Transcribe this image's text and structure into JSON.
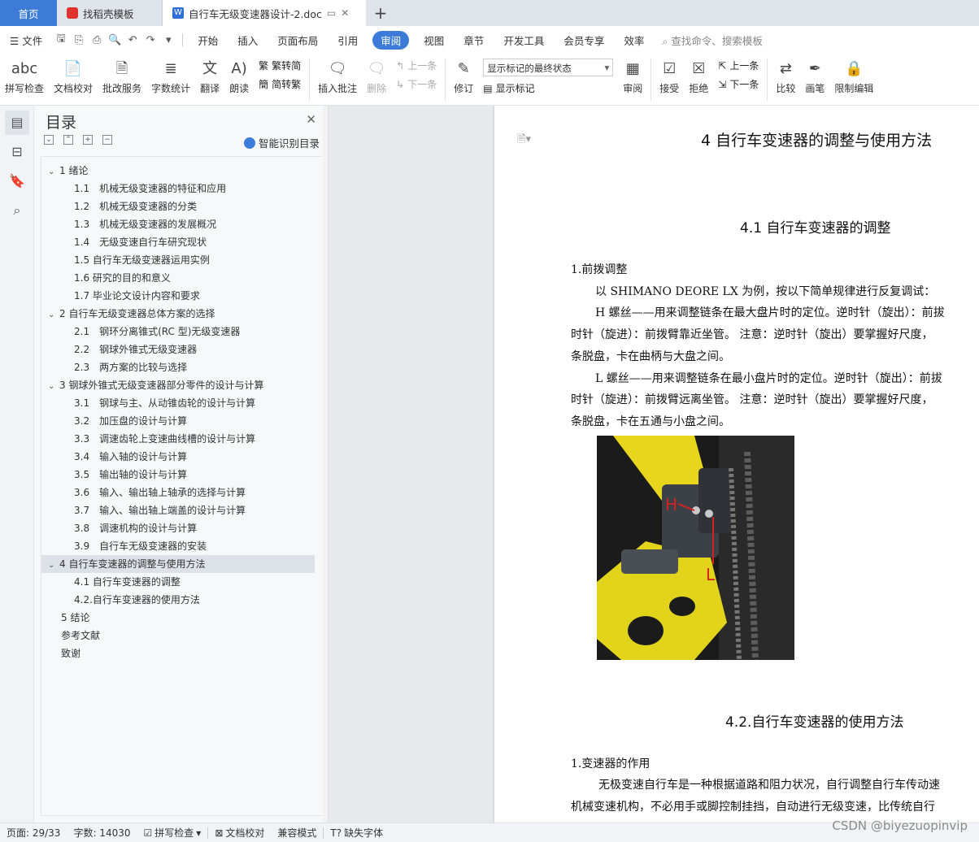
{
  "tabs": {
    "home": "首页",
    "template": "找稻壳模板",
    "document": "自行车无级变速器设计-2.doc"
  },
  "menu": {
    "file": "文件",
    "items": [
      "开始",
      "插入",
      "页面布局",
      "引用",
      "审阅",
      "视图",
      "章节",
      "开发工具",
      "会员专享",
      "效率"
    ],
    "active": "审阅",
    "search": "查找命令、搜索模板"
  },
  "ribbon": {
    "spellcheck": "拼写检查",
    "doccheck": "文档校对",
    "batch": "批改服务",
    "wordcount": "字数统计",
    "translate": "翻译",
    "read": "朗读",
    "to_trad": "繁转简",
    "to_simp": "简转繁",
    "insert_comment": "插入批注",
    "delete": "删除",
    "prev": "上一条",
    "next": "下一条",
    "revise": "修订",
    "markup_state": "显示标记的最终状态",
    "show_markup": "显示标记",
    "review": "审阅",
    "accept": "接受",
    "reject": "拒绝",
    "prev2": "上一条",
    "next2": "下一条",
    "compare": "比较",
    "pen": "画笔",
    "restrict": "限制编辑"
  },
  "toc": {
    "title": "目录",
    "smart": "智能识别目录",
    "items": [
      {
        "level": 1,
        "text": "1 绪论",
        "caret": true
      },
      {
        "level": 2,
        "text": "1.1　机械无级变速器的特征和应用"
      },
      {
        "level": 2,
        "text": "1.2　机械无级变速器的分类"
      },
      {
        "level": 2,
        "text": "1.3　机械无级变速器的发展概况"
      },
      {
        "level": 2,
        "text": "1.4　无级变速自行车研究现状"
      },
      {
        "level": 2,
        "text": "1.5 自行车无级变速器运用实例"
      },
      {
        "level": 2,
        "text": "1.6 研究的目的和意义"
      },
      {
        "level": 2,
        "text": "1.7 毕业论文设计内容和要求"
      },
      {
        "level": 1,
        "text": "2 自行车无级变速器总体方案的选择",
        "caret": true
      },
      {
        "level": 2,
        "text": "2.1　钢环分离锥式(RC 型)无级变速器"
      },
      {
        "level": 2,
        "text": "2.2　钢球外锥式无级变速器"
      },
      {
        "level": 2,
        "text": "2.3　两方案的比较与选择"
      },
      {
        "level": 1,
        "text": "3 钢球外锥式无级变速器部分零件的设计与计算",
        "caret": true
      },
      {
        "level": 2,
        "text": "3.1　钢球与主、从动锥齿轮的设计与计算"
      },
      {
        "level": 2,
        "text": "3.2　加压盘的设计与计算"
      },
      {
        "level": 2,
        "text": "3.3　调速齿轮上变速曲线槽的设计与计算"
      },
      {
        "level": 2,
        "text": "3.4　输入轴的设计与计算"
      },
      {
        "level": 2,
        "text": "3.5　输出轴的设计与计算"
      },
      {
        "level": 2,
        "text": "3.6　输入、输出轴上轴承的选择与计算"
      },
      {
        "level": 2,
        "text": "3.7　输入、输出轴上端盖的设计与计算"
      },
      {
        "level": 2,
        "text": "3.8　调速机构的设计与计算"
      },
      {
        "level": 2,
        "text": "3.9　自行车无级变速器的安装"
      },
      {
        "level": 1,
        "text": "4 自行车变速器的调整与使用方法",
        "caret": true,
        "selected": true
      },
      {
        "level": 2,
        "text": "4.1 自行车变速器的调整"
      },
      {
        "level": 2,
        "text": "4.2.自行车变速器的使用方法"
      },
      {
        "level": 0,
        "text": "5 结论"
      },
      {
        "level": 0,
        "text": "参考文献"
      },
      {
        "level": 0,
        "text": "致谢"
      }
    ]
  },
  "doc": {
    "chapter_title": "4 自行车变速器的调整与使用方法",
    "section1": "4.1 自行车变速器的调整",
    "sub1": "1.前拨调整",
    "lines1": [
      "以 SHIMANO DEORE LX 为例，按以下简单规律进行反复调试：",
      "H 螺丝——用来调整链条在最大盘片时的定位。逆时针（旋出）：前拔",
      "时针（旋进）：前拨臂靠近坐管。 注意：逆时针（旋出）要掌握好尺度，",
      "条脱盘，卡在曲柄与大盘之间。",
      "L 螺丝——用来调整链条在最小盘片时的定位。逆时针（旋出）：前拔",
      "时针（旋进）：前拨臂远离坐管。 注意：逆时针（旋出）要掌握好尺度，",
      "条脱盘，卡在五通与小盘之间。"
    ],
    "photo_labels": {
      "h": "H",
      "l": "L"
    },
    "section2": "4.2.自行车变速器的使用方法",
    "sub2": "1.变速器的作用",
    "lines2": [
      "无极变速自行车是一种根据道路和阻力状况，自行调整自行车传动速",
      "机械变速机构，不必用手或脚控制挂挡，自动进行无级变速，比传统自行"
    ]
  },
  "status": {
    "page": "页面: 29/33",
    "words": "字数: 14030",
    "spell": "拼写检查",
    "doccheck": "文档校对",
    "compat": "兼容模式",
    "missing_font": "缺失字体"
  },
  "watermark": "CSDN @biyezuopinvip"
}
